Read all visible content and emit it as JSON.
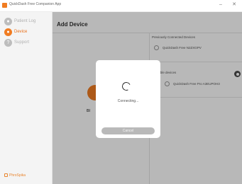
{
  "window": {
    "title": "QuickDash Free Companion App",
    "minimize_glyph": "–",
    "close_glyph": "✕"
  },
  "sidebar": {
    "items": [
      {
        "label": "Patient Log",
        "icon": "person-icon",
        "glyph": "●",
        "active": false
      },
      {
        "label": "Device",
        "icon": "device-icon",
        "glyph": "●",
        "active": true
      },
      {
        "label": "Support",
        "icon": "question-icon",
        "glyph": "?",
        "active": false
      }
    ],
    "brand": "PhroSpika"
  },
  "main": {
    "title": "Add Device",
    "left_panel_text": "Bl",
    "previous_devices": {
      "label": "Previously Connected Devices",
      "items": [
        "QuickDash Free N2ZXGPV"
      ]
    },
    "available_devices": {
      "label": "available devices",
      "items": [
        "QuickDash Free Pro A3EUPOH3"
      ]
    }
  },
  "modal": {
    "status": "Connecting...",
    "cancel_label": "Cancel"
  },
  "colors": {
    "accent": "#f07c22",
    "sidebar_bg": "#f4f4f4"
  }
}
